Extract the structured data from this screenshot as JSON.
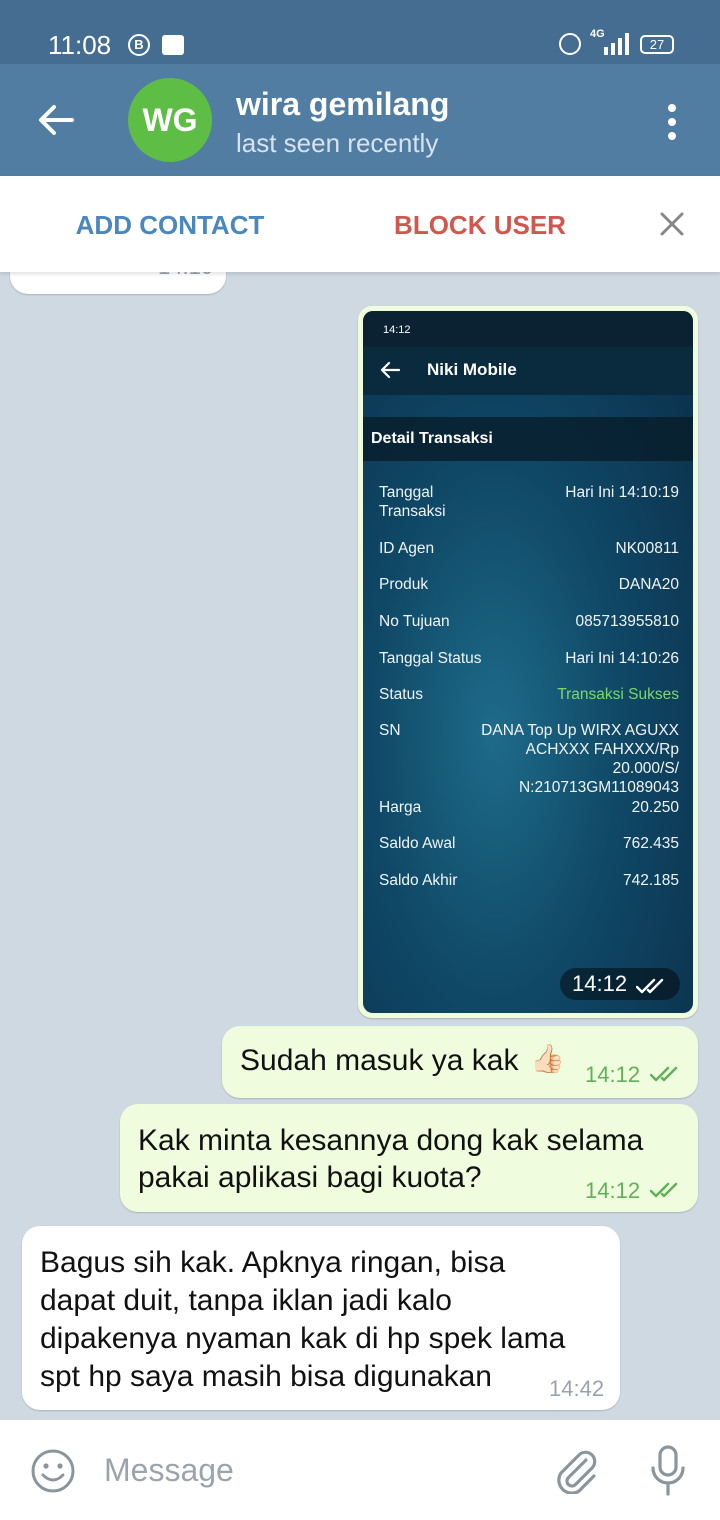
{
  "status_bar": {
    "time": "11:08",
    "b_icon": "B",
    "network": "4G",
    "battery": "27"
  },
  "header": {
    "avatar_initials": "WG",
    "name": "wira gemilang",
    "status": "last seen recently",
    "avatar_color": "#5ebd45"
  },
  "actions": {
    "add_contact": "ADD CONTACT",
    "block_user": "BLOCK USER"
  },
  "messages": {
    "prev_time": "14:10",
    "photo": {
      "time": "14:12",
      "screen": {
        "time": "14:12",
        "app_title": "Niki Mobile",
        "section": "Detail Transaksi",
        "rows": [
          {
            "label": "Tanggal Transaksi",
            "value": "Hari Ini 14:10:19"
          },
          {
            "label": "ID Agen",
            "value": "NK00811"
          },
          {
            "label": "Produk",
            "value": "DANA20"
          },
          {
            "label": "No Tujuan",
            "value": "085713955810"
          },
          {
            "label": "Tanggal Status",
            "value": "Hari Ini 14:10:26"
          },
          {
            "label": "Status",
            "value": "Transaksi Sukses"
          },
          {
            "label": "SN",
            "value": "DANA Top Up WIRX AGUXX ACHXXX FAHXXX/Rp 20.000/S/ N:210713GM11089043"
          },
          {
            "label": "Harga",
            "value": "20.250"
          },
          {
            "label": "Saldo Awal",
            "value": "762.435"
          },
          {
            "label": "Saldo Akhir",
            "value": "742.185"
          }
        ]
      }
    },
    "out1": {
      "text": "Sudah masuk ya kak",
      "emoji": "👍🏻",
      "time": "14:12"
    },
    "out2": {
      "line1": "Kak minta kesannya dong kak selama",
      "line2": "pakai aplikasi bagi kuota?",
      "time": "14:12"
    },
    "in1": {
      "line1": "Bagus sih kak. Apknya ringan, bisa",
      "line2": "dapat duit, tanpa iklan jadi kalo",
      "line3": "dipakenya nyaman kak di hp spek lama",
      "line4": "spt hp saya masih bisa digunakan",
      "time": "14:42"
    }
  },
  "composer": {
    "placeholder": "Message"
  },
  "icons": {
    "back": "arrow-left-icon",
    "menu": "more-vertical-icon",
    "close": "close-icon",
    "emoji": "emoji-icon",
    "attach": "paperclip-icon",
    "mic": "microphone-icon"
  }
}
